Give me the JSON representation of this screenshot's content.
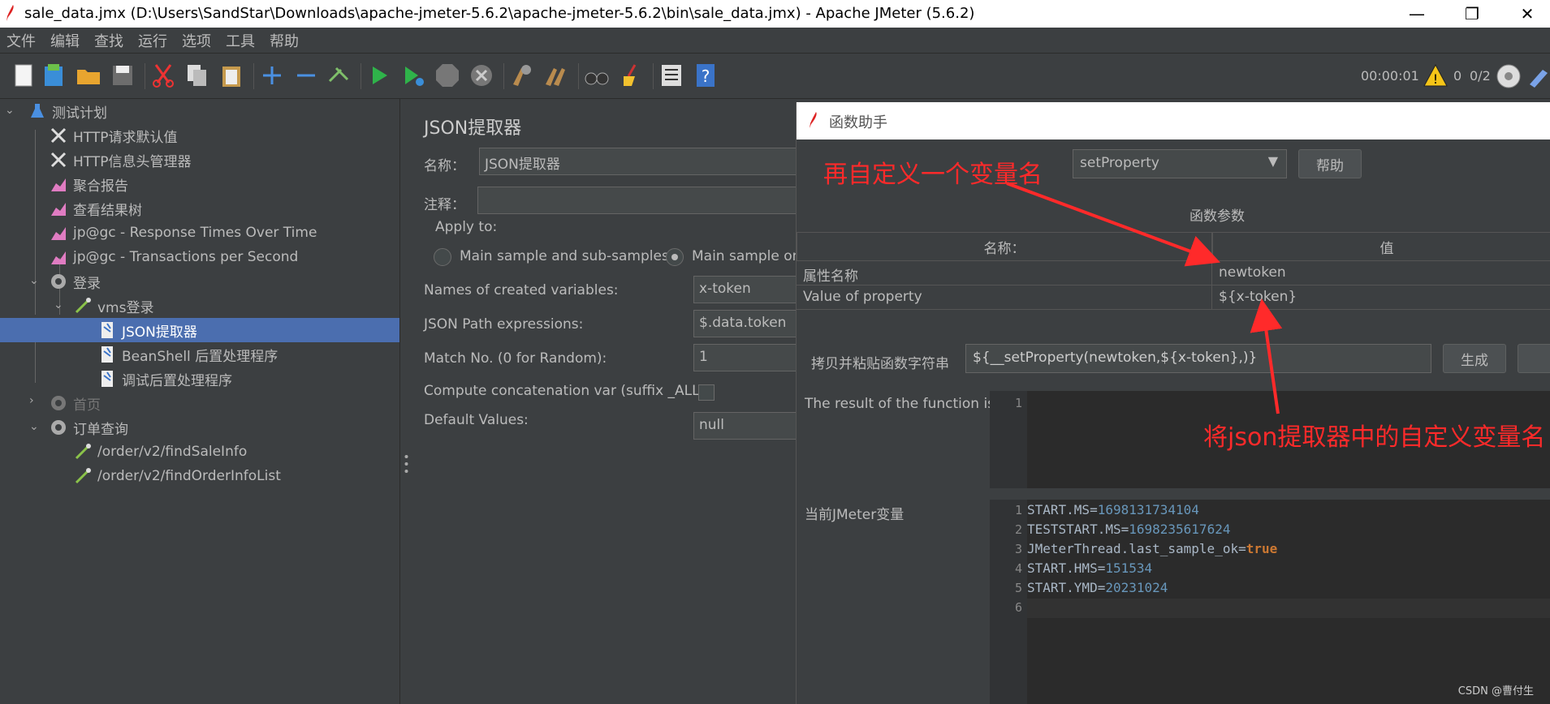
{
  "window": {
    "title": "sale_data.jmx (D:\\Users\\SandStar\\Downloads\\apache-jmeter-5.6.2\\apache-jmeter-5.6.2\\bin\\sale_data.jmx) - Apache JMeter (5.6.2)",
    "minimize": "—",
    "restore": "❐",
    "close": "✕"
  },
  "menu": [
    "文件",
    "编辑",
    "查找",
    "运行",
    "选项",
    "工具",
    "帮助"
  ],
  "status": {
    "timer": "00:00:01",
    "warnings": "0",
    "threads": "0/2"
  },
  "tree": {
    "items": [
      {
        "label": "测试计划"
      },
      {
        "label": "HTTP请求默认值"
      },
      {
        "label": "HTTP信息头管理器"
      },
      {
        "label": "聚合报告"
      },
      {
        "label": "查看结果树"
      },
      {
        "label": "jp@gc - Response Times Over Time"
      },
      {
        "label": "jp@gc - Transactions per Second"
      },
      {
        "label": "登录"
      },
      {
        "label": "vms登录"
      },
      {
        "label": "JSON提取器"
      },
      {
        "label": "BeanShell 后置处理程序"
      },
      {
        "label": "调试后置处理程序"
      },
      {
        "label": "首页"
      },
      {
        "label": "订单查询"
      },
      {
        "label": "/order/v2/findSaleInfo"
      },
      {
        "label": "/order/v2/findOrderInfoList"
      }
    ]
  },
  "extractor": {
    "heading": "JSON提取器",
    "name_label": "名称：",
    "name_value": "JSON提取器",
    "comment_label": "注释：",
    "apply_to_label": "Apply to:",
    "radio_main_sub": "Main sample and sub-samples",
    "radio_main_only": "Main sample on",
    "names_label": "Names of created variables:",
    "names_value": "x-token",
    "path_label": "JSON Path expressions:",
    "path_value": "$.data.token",
    "match_label": "Match No. (0 for Random):",
    "match_value": "1",
    "concat_label": "Compute concatenation var (suffix _ALL):",
    "default_label": "Default Values:",
    "default_value": "null"
  },
  "dialog": {
    "title": "函数助手",
    "function_selected": "setProperty",
    "help_button": "帮助",
    "params_caption": "函数参数",
    "col_name": "名称：",
    "col_value": "值",
    "params": [
      {
        "name": "属性名称",
        "value": "newtoken"
      },
      {
        "name": "Value of property",
        "value": "${x-token}"
      }
    ],
    "copy_label": "拷贝并粘贴函数字符串",
    "copy_value": "${__setProperty(newtoken,${x-token},)}",
    "generate_button": "生成",
    "result_label": "The result of the function is",
    "result_lines": [
      "1"
    ],
    "vars_label": "当前JMeter变量",
    "vars_lines": [
      {
        "ln": "1",
        "key": "START.MS=",
        "val": "1698131734104",
        "kind": "num"
      },
      {
        "ln": "2",
        "key": "TESTSTART.MS=",
        "val": "1698235617624",
        "kind": "num"
      },
      {
        "ln": "3",
        "key": "JMeterThread.last_sample_ok=",
        "val": "true",
        "kind": "kw"
      },
      {
        "ln": "4",
        "key": "START.HMS=",
        "val": "151534",
        "kind": "num"
      },
      {
        "ln": "5",
        "key": "START.YMD=",
        "val": "20231024",
        "kind": "num"
      },
      {
        "ln": "6",
        "key": "",
        "val": "",
        "kind": ""
      }
    ]
  },
  "annotations": {
    "top": "再自定义一个变量名",
    "bottom": "将json提取器中的自定义变量名"
  },
  "watermark": "CSDN @曹付生",
  "colors": {
    "selection": "#4b6eaf",
    "annotation": "#ff2a2a",
    "background": "#3c3f41"
  }
}
